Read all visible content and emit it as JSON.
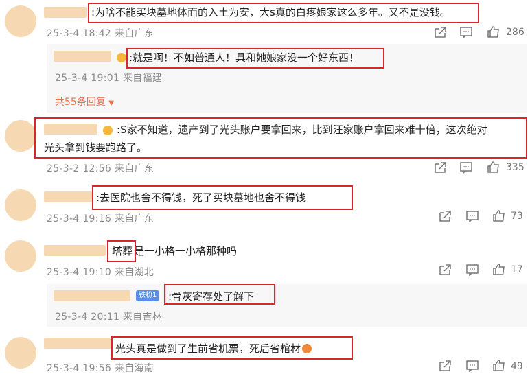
{
  "comments": [
    {
      "text": ":为啥不能买块墓地体面的入土为安，大s真的白疼娘家这么多年。又不是没钱。",
      "meta": "25-3-4 18:42 来自广东",
      "likes": "286"
    },
    {
      "text": ":就是啊！不如普通人！具和她娘家没一个好东西！",
      "meta": "25-3-4 19:01 来自福建"
    },
    {
      "more": "共55条回复"
    },
    {
      "line1": ":S家不知道，遗产到了光头账户要拿回来，比到汪家账户拿回来难十倍，这次绝对",
      "line2": "光头拿到钱要跑路了。",
      "meta": "25-3-2 12:56 来自广东",
      "likes": "335"
    },
    {
      "text": ":去医院也舍不得钱，死了买块墓地也舍不得钱",
      "meta": "25-3-4 19:16 来自广东",
      "likes": "73"
    },
    {
      "highlight": "塔葬",
      "rest": "是一小格一小格那种吗",
      "meta": "25-3-4 19:10 来自湖北",
      "likes": "17"
    },
    {
      "badge": "铁粉1",
      "text": ":骨灰寄存处了解下",
      "meta": "25-3-4 20:11 来自吉林"
    },
    {
      "text": "光头真是做到了生前省机票，死后省棺材",
      "meta": "25-3-4 19:56 来自海南",
      "likes": "49"
    }
  ],
  "icons": {
    "share": "share-icon",
    "comment": "comment-icon",
    "like": "like-icon",
    "expand": "caret-down-icon"
  },
  "colors": {
    "highlight_box": "#d9262c",
    "meta": "#8c8c8c",
    "link": "#eb7350",
    "avatar": "#f6d9b3"
  }
}
